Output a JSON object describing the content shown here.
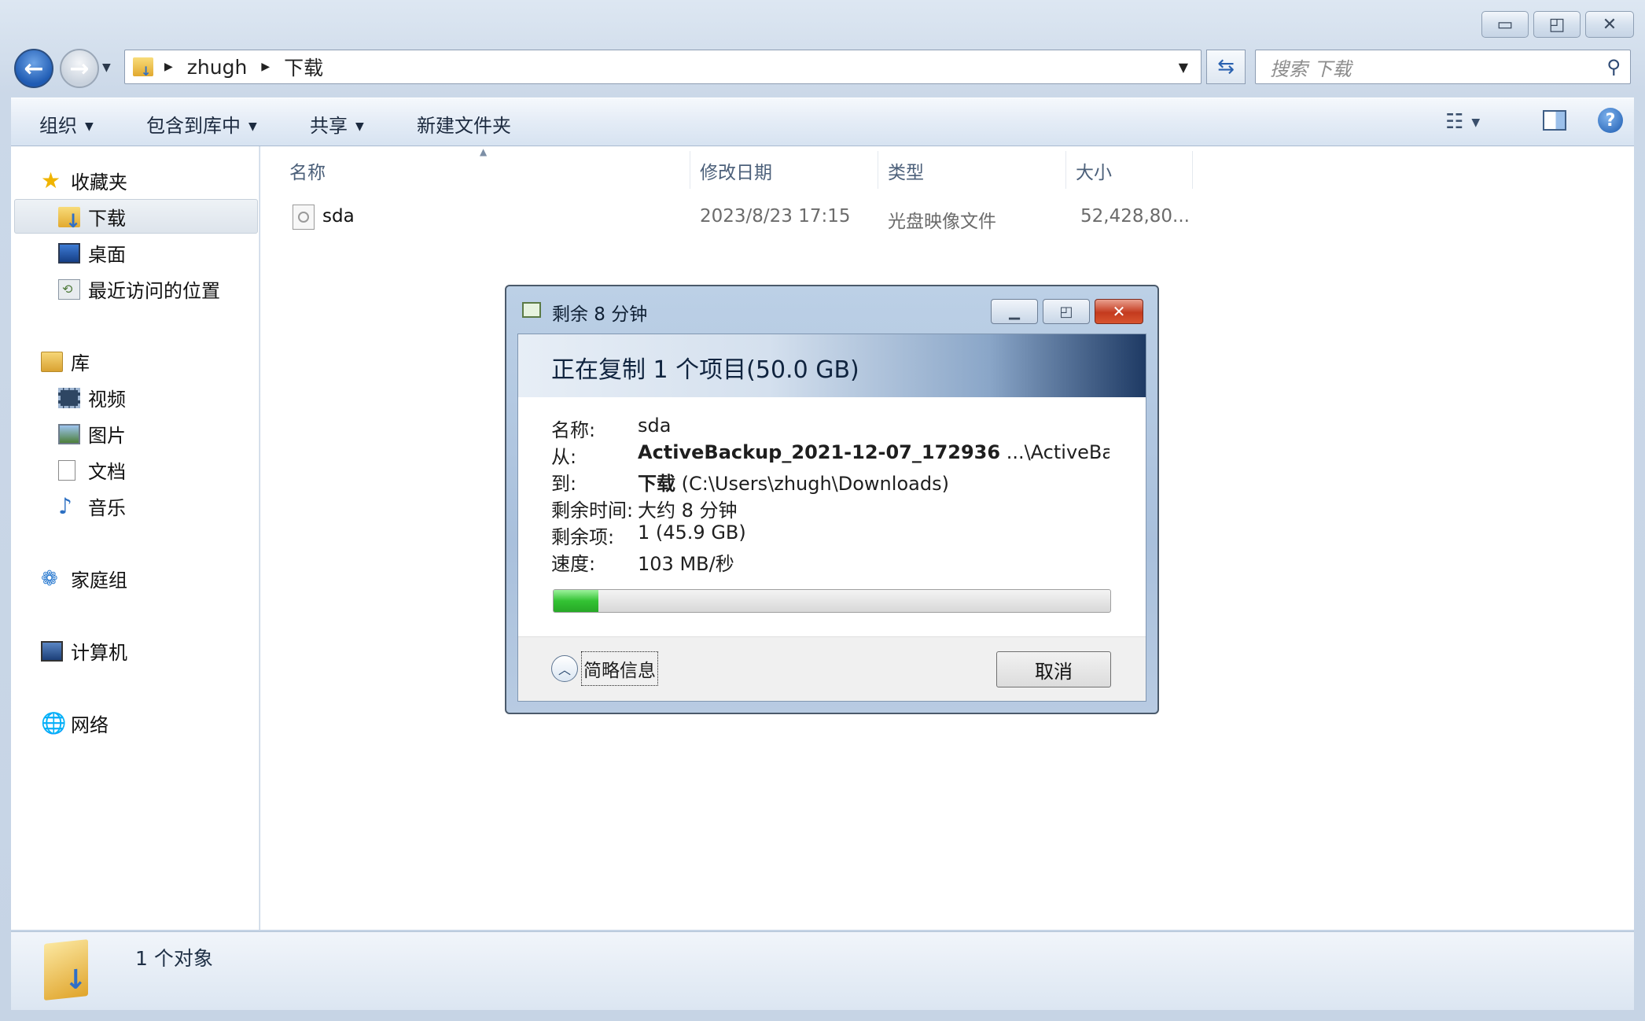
{
  "window": {
    "minimize_glyph": "▭",
    "maximize_glyph": "◰",
    "close_glyph": "✕"
  },
  "address": {
    "crumbs": [
      "zhugh",
      "下载"
    ],
    "search_placeholder": "搜索 下载"
  },
  "toolbar": {
    "organize": "组织",
    "include_in_library": "包含到库中",
    "share": "共享",
    "new_folder": "新建文件夹"
  },
  "nav": {
    "favorites": "收藏夹",
    "downloads": "下载",
    "desktop": "桌面",
    "recent_places": "最近访问的位置",
    "libraries": "库",
    "videos": "视频",
    "pictures": "图片",
    "documents": "文档",
    "music": "音乐",
    "homegroup": "家庭组",
    "computer": "计算机",
    "network": "网络"
  },
  "columns": {
    "name": "名称",
    "modified": "修改日期",
    "type": "类型",
    "size": "大小"
  },
  "files": [
    {
      "name": "sda",
      "modified": "2023/8/23 17:15",
      "type": "光盘映像文件",
      "size": "52,428,80..."
    }
  ],
  "status": {
    "count": "1 个对象"
  },
  "dialog": {
    "title": "剩余 8 分钟",
    "heading": "正在复制 1 个项目(50.0 GB)",
    "labels": {
      "name": "名称:",
      "from": "从:",
      "to": "到:",
      "time_left": "剩余时间:",
      "items_left": "剩余项:",
      "speed": "速度:"
    },
    "values": {
      "name": "sda",
      "from_bold": "ActiveBackup_2021-12-07_172936",
      "from_rest": " ...\\ActiveBackup",
      "to_bold": "下载",
      "to_rest": " (C:\\Users\\zhugh\\Downloads)",
      "time_left": "大约 8 分钟",
      "items_left": "1 (45.9 GB)",
      "speed": "103 MB/秒"
    },
    "progress_percent": 8,
    "less_info": "简略信息",
    "cancel": "取消"
  }
}
